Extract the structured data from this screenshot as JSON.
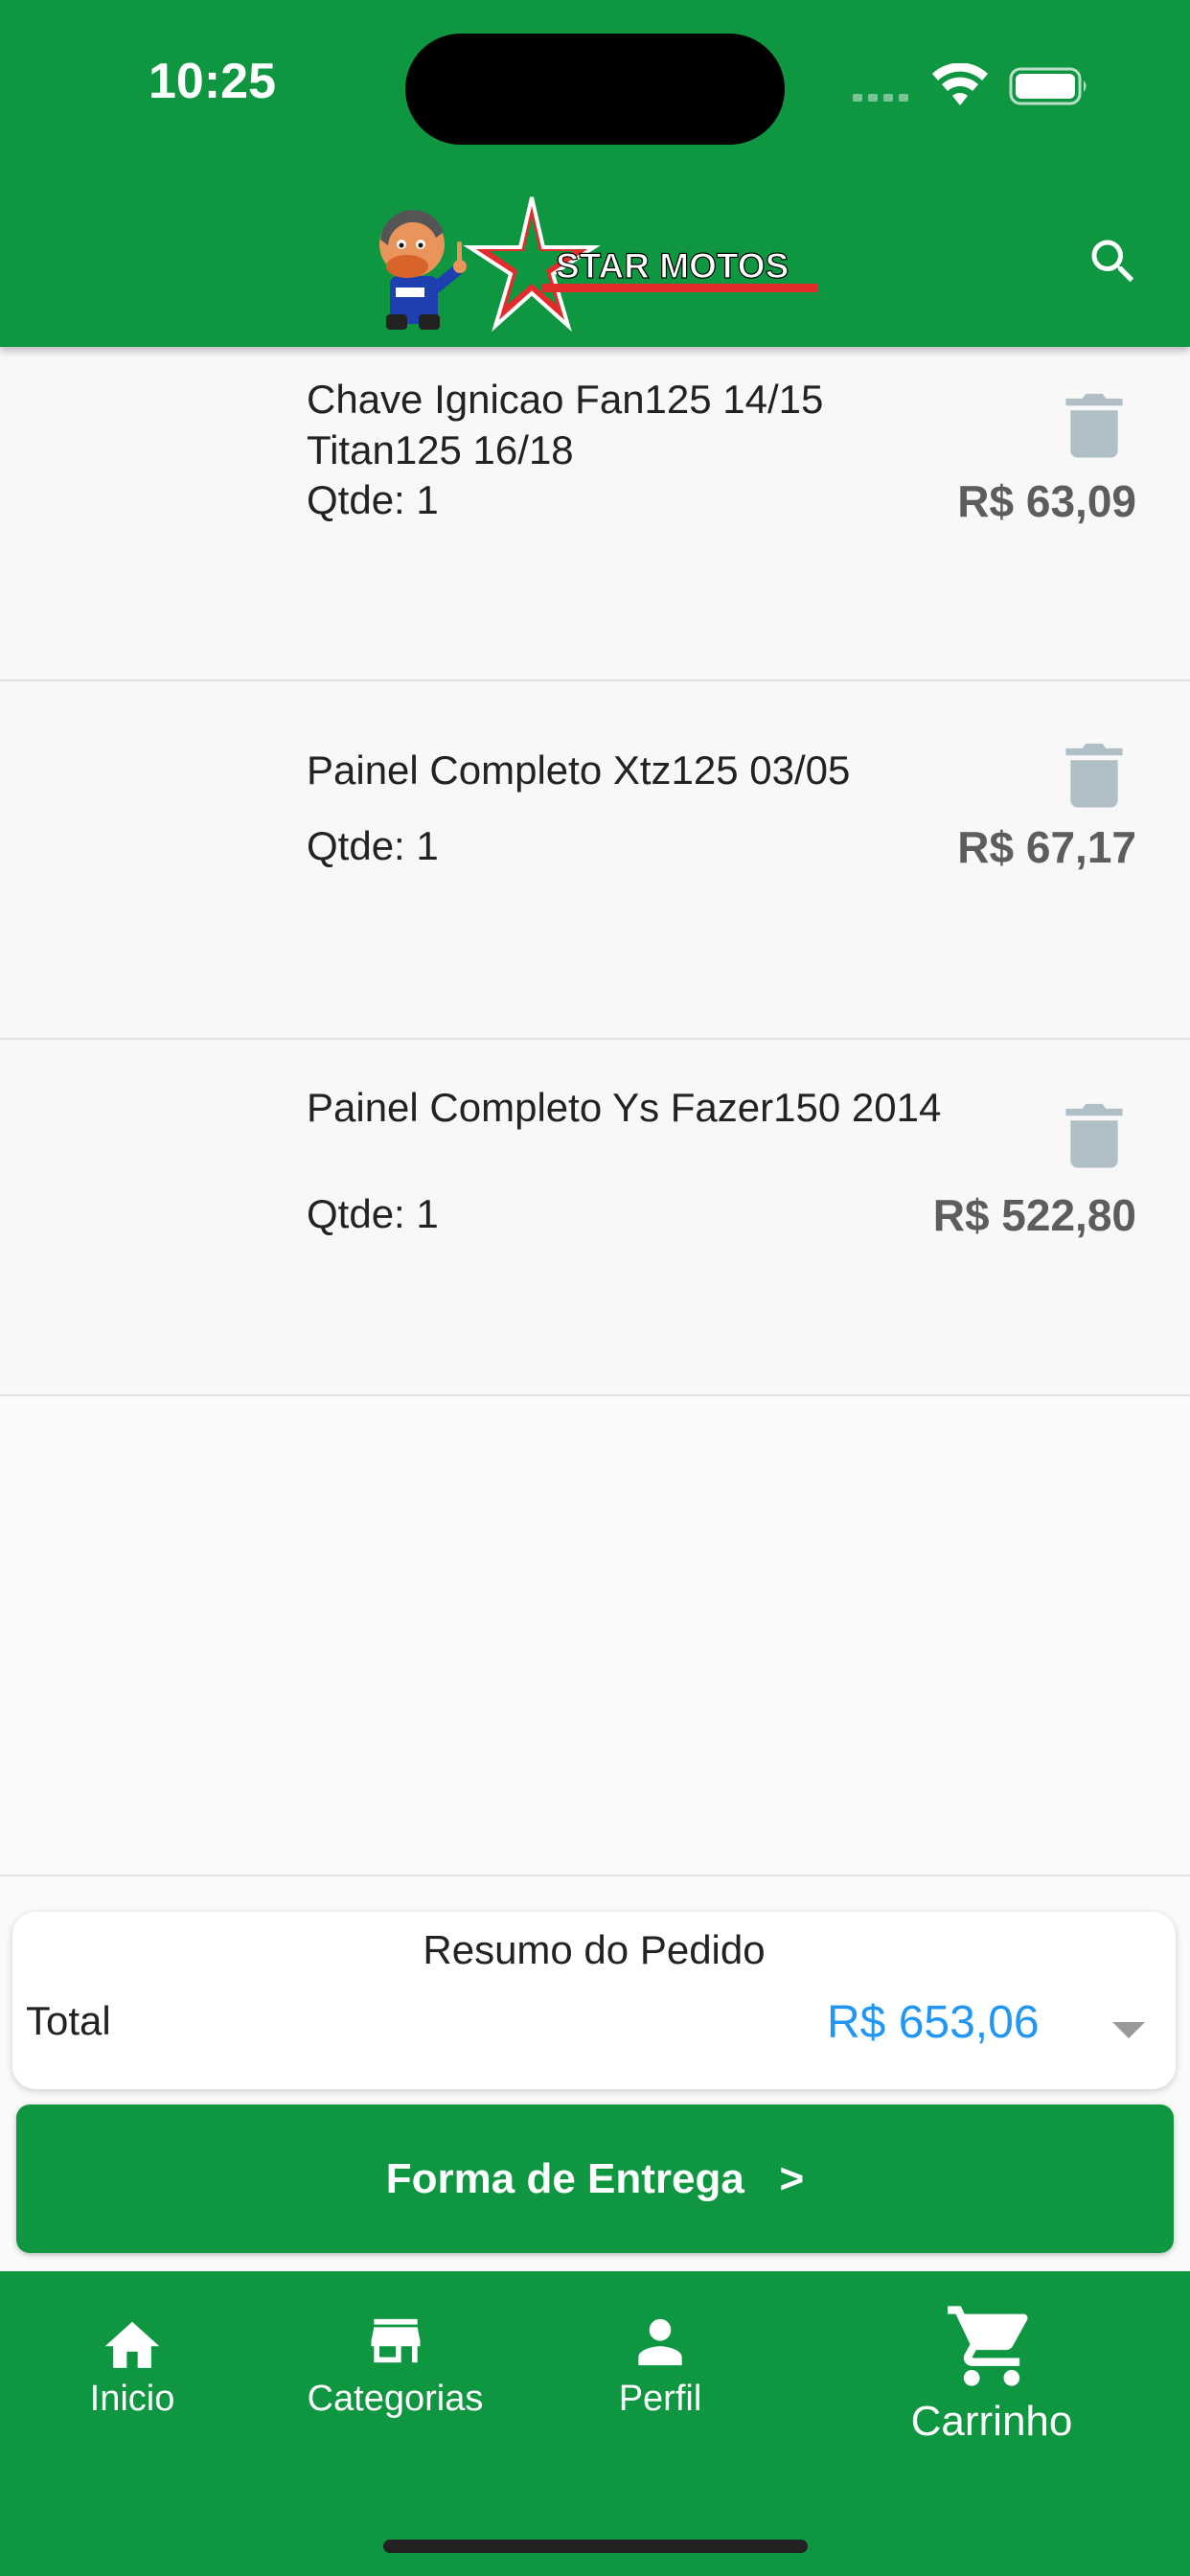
{
  "status_bar": {
    "time": "10:25"
  },
  "header": {
    "brand": "STAR MOTOS"
  },
  "cart_items": [
    {
      "name": "Chave Ignicao Fan125 14/15 Titan125 16/18",
      "qty_label": "Qtde: 1",
      "price": "R$ 63,09"
    },
    {
      "name": "Painel Completo Xtz125 03/05",
      "qty_label": "Qtde: 1",
      "price": "R$ 67,17"
    },
    {
      "name": "Painel Completo Ys  Fazer150 2014",
      "qty_label": "Qtde: 1",
      "price": "R$ 522,80"
    }
  ],
  "summary": {
    "title": "Resumo do Pedido",
    "total_label": "Total",
    "total_value": "R$ 653,06"
  },
  "delivery_button": {
    "label": "Forma de Entrega   >"
  },
  "bottom_nav": [
    {
      "label": "Inicio",
      "icon": "home-icon"
    },
    {
      "label": "Categorias",
      "icon": "store-icon"
    },
    {
      "label": "Perfil",
      "icon": "person-icon"
    },
    {
      "label": "Carrinho",
      "icon": "cart-icon"
    }
  ],
  "colors": {
    "brand_green": "#0e9641",
    "total_blue": "#2196f3",
    "trash_gray": "#b0bec5"
  }
}
